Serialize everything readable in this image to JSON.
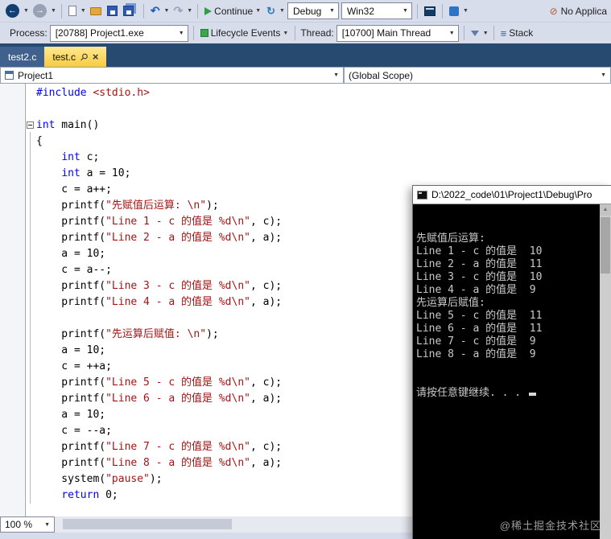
{
  "toolbar_main": {
    "continue_label": "Continue",
    "debug_value": "Debug",
    "platform_value": "Win32",
    "no_app_label": "No Applica"
  },
  "toolbar_debug": {
    "process_label": "Process:",
    "process_value": "[20788] Project1.exe",
    "lifecycle_label": "Lifecycle Events",
    "thread_label": "Thread:",
    "thread_value": "[10700] Main Thread",
    "stack_label": "Stack"
  },
  "tabs": {
    "tab1": "test2.c",
    "tab2": "test.c"
  },
  "navbar": {
    "project": "Project1",
    "scope": "(Global Scope)"
  },
  "editor": {
    "lines": [
      [
        [
          "k",
          "#include "
        ],
        [
          "s",
          "<stdio.h>"
        ]
      ],
      [],
      [
        [
          "k",
          "int"
        ],
        [
          "pl",
          " main()"
        ]
      ],
      [
        [
          "pl",
          "{"
        ]
      ],
      [
        [
          "pl",
          "    "
        ],
        [
          "k",
          "int"
        ],
        [
          "pl",
          " c;"
        ]
      ],
      [
        [
          "pl",
          "    "
        ],
        [
          "k",
          "int"
        ],
        [
          "pl",
          " a = 10;"
        ]
      ],
      [
        [
          "pl",
          "    c = a++;"
        ]
      ],
      [
        [
          "pl",
          "    printf("
        ],
        [
          "s",
          "\"先赋值后运算: \\n\""
        ],
        [
          "pl",
          ");"
        ]
      ],
      [
        [
          "pl",
          "    printf("
        ],
        [
          "s",
          "\"Line 1 - c 的值是 %d\\n\""
        ],
        [
          "pl",
          ", c);"
        ]
      ],
      [
        [
          "pl",
          "    printf("
        ],
        [
          "s",
          "\"Line 2 - a 的值是 %d\\n\""
        ],
        [
          "pl",
          ", a);"
        ]
      ],
      [
        [
          "pl",
          "    a = 10;"
        ]
      ],
      [
        [
          "pl",
          "    c = a--;"
        ]
      ],
      [
        [
          "pl",
          "    printf("
        ],
        [
          "s",
          "\"Line 3 - c 的值是 %d\\n\""
        ],
        [
          "pl",
          ", c);"
        ]
      ],
      [
        [
          "pl",
          "    printf("
        ],
        [
          "s",
          "\"Line 4 - a 的值是 %d\\n\""
        ],
        [
          "pl",
          ", a);"
        ]
      ],
      [],
      [
        [
          "pl",
          "    printf("
        ],
        [
          "s",
          "\"先运算后赋值: \\n\""
        ],
        [
          "pl",
          ");"
        ]
      ],
      [
        [
          "pl",
          "    a = 10;"
        ]
      ],
      [
        [
          "pl",
          "    c = ++a;"
        ]
      ],
      [
        [
          "pl",
          "    printf("
        ],
        [
          "s",
          "\"Line 5 - c 的值是 %d\\n\""
        ],
        [
          "pl",
          ", c);"
        ]
      ],
      [
        [
          "pl",
          "    printf("
        ],
        [
          "s",
          "\"Line 6 - a 的值是 %d\\n\""
        ],
        [
          "pl",
          ", a);"
        ]
      ],
      [
        [
          "pl",
          "    a = 10;"
        ]
      ],
      [
        [
          "pl",
          "    c = --a;"
        ]
      ],
      [
        [
          "pl",
          "    printf("
        ],
        [
          "s",
          "\"Line 7 - c 的值是 %d\\n\""
        ],
        [
          "pl",
          ", c);"
        ]
      ],
      [
        [
          "pl",
          "    printf("
        ],
        [
          "s",
          "\"Line 8 - a 的值是 %d\\n\""
        ],
        [
          "pl",
          ", a);"
        ]
      ],
      [
        [
          "pl",
          "    system("
        ],
        [
          "s",
          "\"pause\""
        ],
        [
          "pl",
          ");"
        ]
      ],
      [
        [
          "pl",
          "    "
        ],
        [
          "k",
          "return"
        ],
        [
          "pl",
          " 0;"
        ]
      ]
    ]
  },
  "console": {
    "title": "D:\\2022_code\\01\\Project1\\Debug\\Pro",
    "lines": [
      "先赋值后运算:",
      "Line 1 - c 的值是  10",
      "Line 2 - a 的值是  11",
      "Line 3 - c 的值是  10",
      "Line 4 - a 的值是  9",
      "先运算后赋值:",
      "Line 5 - c 的值是  11",
      "Line 6 - a 的值是  11",
      "Line 7 - c 的值是  9",
      "Line 8 - a 的值是  9"
    ],
    "prompt": "请按任意键继续. . . "
  },
  "statusbar": {
    "zoom": "100 %"
  },
  "watermark": "@稀土掘金技术社区",
  "colors": {
    "keyword": "#0000ff",
    "string": "#a31515",
    "console_bg": "#000000",
    "tab_active": "#f6cb41"
  }
}
